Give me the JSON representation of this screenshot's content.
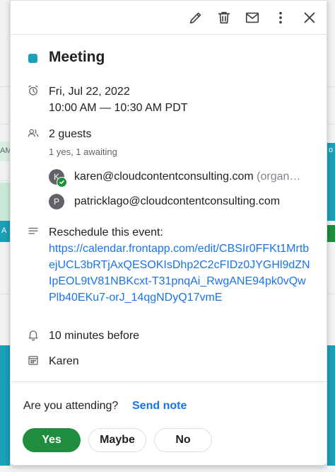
{
  "event": {
    "title": "Meeting",
    "color": "#1aa0b7",
    "date": "Fri, Jul 22, 2022",
    "time": "10:00 AM — 10:30 AM PDT"
  },
  "guests": {
    "count_label": "2 guests",
    "summary": "1 yes, 1 awaiting",
    "list": [
      {
        "initial": "K",
        "email": "karen@cloudcontentconsulting.com",
        "role": "(organ…",
        "accepted": true
      },
      {
        "initial": "P",
        "email": "patricklago@cloudcontentconsulting.com",
        "role": "",
        "accepted": false
      }
    ]
  },
  "description": {
    "heading": "Reschedule this event:",
    "link": "https://calendar.frontapp.com/edit/CBSIr0FFKt1MrtbejUCL3bRTjAxQESOKIsDhp2C2cFIDz0JYGHl9dZNIpEOL9tV81NBKcxt-T31pnqAi_RwgANE94pk0vQwPlb40EKu7-orJ_14qgNDyQ17vmE"
  },
  "reminder": "10 minutes before",
  "calendar_owner": "Karen",
  "rsvp": {
    "question": "Are you attending?",
    "send_note": "Send note",
    "yes": "Yes",
    "maybe": "Maybe",
    "no": "No"
  },
  "background": {
    "left_label_1": "AM",
    "left_label_2": "A",
    "right_label": "o"
  }
}
